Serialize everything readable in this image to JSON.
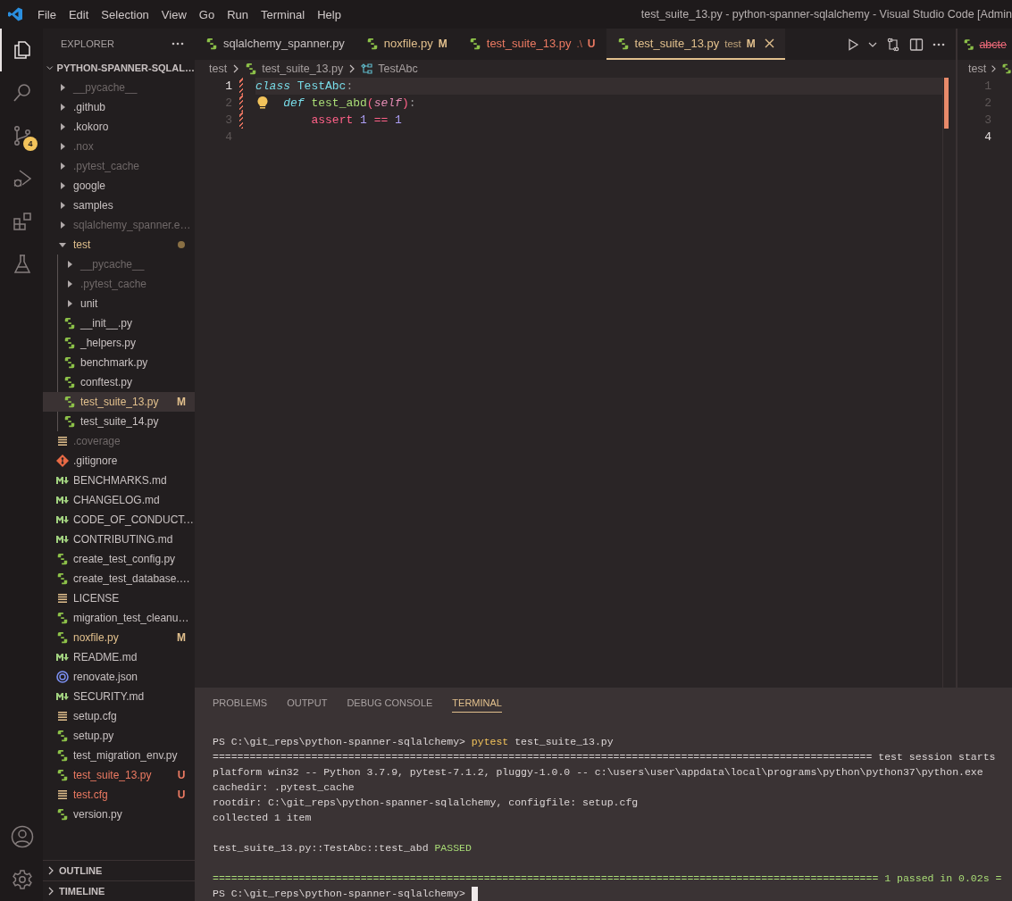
{
  "title_bar": {
    "menu": [
      "File",
      "Edit",
      "Selection",
      "View",
      "Go",
      "Run",
      "Terminal",
      "Help"
    ],
    "title": "test_suite_13.py - python-spanner-sqlalchemy - Visual Studio Code [Admin"
  },
  "activity_bar": {
    "items": [
      {
        "kind": "explorer",
        "selected": true
      },
      {
        "kind": "search",
        "selected": false
      },
      {
        "kind": "source-control",
        "selected": false,
        "badge": "4"
      },
      {
        "kind": "run-debug",
        "selected": false
      },
      {
        "kind": "extensions",
        "selected": false
      },
      {
        "kind": "testing",
        "selected": false
      }
    ],
    "bottom_items": [
      {
        "kind": "account",
        "selected": false
      },
      {
        "kind": "settings",
        "selected": false
      }
    ]
  },
  "sidebar": {
    "title": "EXPLORER",
    "section": {
      "label": "PYTHON-SPANNER-SQLAL…",
      "expanded": true
    },
    "items": [
      {
        "label": "__pycache__",
        "kind": "folder",
        "expanded": false,
        "dimmed": true,
        "modified": false,
        "untracked": false,
        "selected": false
      },
      {
        "label": ".github",
        "kind": "folder",
        "expanded": false,
        "dimmed": false,
        "modified": false,
        "untracked": false,
        "selected": false
      },
      {
        "label": ".kokoro",
        "kind": "folder",
        "expanded": false,
        "dimmed": false,
        "modified": false,
        "untracked": false,
        "selected": false
      },
      {
        "label": ".nox",
        "kind": "folder",
        "expanded": false,
        "dimmed": true,
        "modified": false,
        "untracked": false,
        "selected": false
      },
      {
        "label": ".pytest_cache",
        "kind": "folder",
        "expanded": false,
        "dimmed": true,
        "modified": false,
        "untracked": false,
        "selected": false
      },
      {
        "label": "google",
        "kind": "folder",
        "expanded": false,
        "dimmed": false,
        "modified": false,
        "untracked": false,
        "selected": false
      },
      {
        "label": "samples",
        "kind": "folder",
        "expanded": false,
        "dimmed": false,
        "modified": false,
        "untracked": false,
        "selected": false
      },
      {
        "label": "sqlalchemy_spanner.e…",
        "kind": "folder",
        "expanded": false,
        "dimmed": true,
        "modified": false,
        "untracked": false,
        "selected": false
      },
      {
        "label": "test",
        "kind": "folder",
        "expanded": true,
        "dimmed": false,
        "modified": true,
        "untracked": false,
        "selected": false,
        "children": [
          {
            "label": "__pycache__",
            "kind": "folder",
            "expanded": false,
            "dimmed": true,
            "modified": false,
            "untracked": false,
            "selected": false
          },
          {
            "label": ".pytest_cache",
            "kind": "folder",
            "expanded": false,
            "dimmed": true,
            "modified": false,
            "untracked": false,
            "selected": false
          },
          {
            "label": "unit",
            "kind": "folder",
            "expanded": false,
            "dimmed": false,
            "modified": false,
            "untracked": false,
            "selected": false
          },
          {
            "label": "__init__.py",
            "kind": "python-file",
            "dimmed": false,
            "modified": false,
            "untracked": false,
            "selected": false
          },
          {
            "label": "_helpers.py",
            "kind": "python-file",
            "dimmed": false,
            "modified": false,
            "untracked": false,
            "selected": false
          },
          {
            "label": "benchmark.py",
            "kind": "python-file",
            "dimmed": false,
            "modified": false,
            "untracked": false,
            "selected": false
          },
          {
            "label": "conftest.py",
            "kind": "python-file",
            "dimmed": false,
            "modified": false,
            "untracked": false,
            "selected": false
          },
          {
            "label": "test_suite_13.py",
            "kind": "python-file",
            "dimmed": false,
            "modified": true,
            "untracked": false,
            "badge": "M",
            "selected": true
          },
          {
            "label": "test_suite_14.py",
            "kind": "python-file",
            "dimmed": false,
            "modified": false,
            "untracked": false,
            "selected": false
          }
        ]
      },
      {
        "label": ".coverage",
        "kind": "text-file",
        "dimmed": true,
        "modified": false,
        "untracked": false,
        "selected": false
      },
      {
        "label": ".gitignore",
        "kind": "git-file",
        "dimmed": false,
        "modified": false,
        "untracked": false,
        "selected": false
      },
      {
        "label": "BENCHMARKS.md",
        "kind": "markdown-file",
        "dimmed": false,
        "modified": false,
        "untracked": false,
        "selected": false
      },
      {
        "label": "CHANGELOG.md",
        "kind": "markdown-file",
        "dimmed": false,
        "modified": false,
        "untracked": false,
        "selected": false
      },
      {
        "label": "CODE_OF_CONDUCT.…",
        "kind": "markdown-file",
        "dimmed": false,
        "modified": false,
        "untracked": false,
        "selected": false
      },
      {
        "label": "CONTRIBUTING.md",
        "kind": "markdown-file",
        "dimmed": false,
        "modified": false,
        "untracked": false,
        "selected": false
      },
      {
        "label": "create_test_config.py",
        "kind": "python-file",
        "dimmed": false,
        "modified": false,
        "untracked": false,
        "selected": false
      },
      {
        "label": "create_test_database.…",
        "kind": "python-file",
        "dimmed": false,
        "modified": false,
        "untracked": false,
        "selected": false
      },
      {
        "label": "LICENSE",
        "kind": "text-file",
        "dimmed": false,
        "modified": false,
        "untracked": false,
        "selected": false
      },
      {
        "label": "migration_test_cleanu…",
        "kind": "python-file",
        "dimmed": false,
        "modified": false,
        "untracked": false,
        "selected": false
      },
      {
        "label": "noxfile.py",
        "kind": "python-file",
        "dimmed": false,
        "modified": true,
        "untracked": false,
        "badge": "M",
        "selected": false
      },
      {
        "label": "README.md",
        "kind": "markdown-file",
        "dimmed": false,
        "modified": false,
        "untracked": false,
        "selected": false
      },
      {
        "label": "renovate.json",
        "kind": "json-file",
        "dimmed": false,
        "modified": false,
        "untracked": false,
        "selected": false
      },
      {
        "label": "SECURITY.md",
        "kind": "markdown-file",
        "dimmed": false,
        "modified": false,
        "untracked": false,
        "selected": false
      },
      {
        "label": "setup.cfg",
        "kind": "text-file",
        "dimmed": false,
        "modified": false,
        "untracked": false,
        "selected": false
      },
      {
        "label": "setup.py",
        "kind": "python-file",
        "dimmed": false,
        "modified": false,
        "untracked": false,
        "selected": false
      },
      {
        "label": "test_migration_env.py",
        "kind": "python-file",
        "dimmed": false,
        "modified": false,
        "untracked": false,
        "selected": false
      },
      {
        "label": "test_suite_13.py",
        "kind": "python-file",
        "dimmed": false,
        "modified": false,
        "untracked": true,
        "badge": "U",
        "selected": false
      },
      {
        "label": "test.cfg",
        "kind": "text-file",
        "dimmed": false,
        "modified": false,
        "untracked": true,
        "badge": "U",
        "selected": false
      },
      {
        "label": "version.py",
        "kind": "python-file",
        "dimmed": false,
        "modified": false,
        "untracked": false,
        "selected": false
      }
    ],
    "bottom_sections": [
      {
        "label": "OUTLINE",
        "expanded": false
      },
      {
        "label": "TIMELINE",
        "expanded": false
      }
    ]
  },
  "editor": {
    "tabs": [
      {
        "label": "sqlalchemy_spanner.py",
        "modified": false,
        "untracked": false,
        "selected": false
      },
      {
        "label": "noxfile.py",
        "modified": true,
        "untracked": false,
        "badge": "M",
        "selected": false
      },
      {
        "label": "test_suite_13.py",
        "description": ".\\",
        "modified": false,
        "untracked": true,
        "badge": "U",
        "selected": false
      },
      {
        "label": "test_suite_13.py",
        "description": "test",
        "modified": true,
        "untracked": false,
        "badge": "M",
        "selected": true
      }
    ],
    "breadcrumb": [
      {
        "label": "test",
        "kind": "folder"
      },
      {
        "label": "test_suite_13.py",
        "kind": "python"
      },
      {
        "label": "TestAbc",
        "kind": "class"
      }
    ],
    "lines": [
      {
        "number": "1",
        "current": true,
        "changed": true,
        "lightbulb": false,
        "tokens": [
          {
            "text": "class",
            "kind": "storage"
          },
          {
            "text": " TestAbc",
            "kind": "type"
          },
          {
            "text": ":",
            "kind": "punct"
          }
        ]
      },
      {
        "number": "2",
        "current": false,
        "changed": true,
        "lightbulb": true,
        "tokens": [
          {
            "text": "    def",
            "kind": "storage"
          },
          {
            "text": " test_abd",
            "kind": "function"
          },
          {
            "text": "(",
            "kind": "operator"
          },
          {
            "text": "self",
            "kind": "param"
          },
          {
            "text": ")",
            "kind": "operator"
          },
          {
            "text": ":",
            "kind": "punct"
          }
        ]
      },
      {
        "number": "3",
        "current": false,
        "changed": true,
        "lightbulb": false,
        "tokens": [
          {
            "text": "        assert",
            "kind": "keyword"
          },
          {
            "text": " 1",
            "kind": "number"
          },
          {
            "text": " ==",
            "kind": "operator"
          },
          {
            "text": " 1",
            "kind": "number"
          }
        ]
      },
      {
        "number": "4",
        "current": false,
        "changed": false,
        "lightbulb": false
      }
    ]
  },
  "side_editor": {
    "tab": {
      "label": "abcte",
      "deleted": true
    },
    "breadcrumb": "test",
    "lines": [
      {
        "number": "1",
        "current": false
      },
      {
        "number": "2",
        "current": false
      },
      {
        "number": "3",
        "current": false
      },
      {
        "number": "4",
        "current": true
      }
    ]
  },
  "panel": {
    "tabs": [
      {
        "label": "PROBLEMS",
        "selected": false
      },
      {
        "label": "OUTPUT",
        "selected": false
      },
      {
        "label": "DEBUG CONSOLE",
        "selected": false
      },
      {
        "label": "TERMINAL",
        "selected": true
      }
    ],
    "terminal": [
      {
        "kind": "text",
        "segments": [
          {
            "text": "PS C:\\git_reps\\python-spanner-sqlalchemy> ",
            "kind": "plain"
          },
          {
            "text": "pytest",
            "kind": "command"
          },
          {
            "text": " test_suite_13.py",
            "kind": "plain"
          }
        ]
      },
      {
        "kind": "text",
        "segments": [
          {
            "text": "=========================================================================================================== test session starts",
            "kind": "plain"
          }
        ]
      },
      {
        "kind": "text",
        "segments": [
          {
            "text": "platform win32 -- Python 3.7.9, pytest-7.1.2, pluggy-1.0.0 -- c:\\users\\user\\appdata\\local\\programs\\python\\python37\\python.exe",
            "kind": "plain"
          }
        ]
      },
      {
        "kind": "text",
        "segments": [
          {
            "text": "cachedir: .pytest_cache",
            "kind": "plain"
          }
        ]
      },
      {
        "kind": "text",
        "segments": [
          {
            "text": "rootdir: C:\\git_reps\\python-spanner-sqlalchemy, configfile: setup.cfg",
            "kind": "plain"
          }
        ]
      },
      {
        "kind": "text",
        "segments": [
          {
            "text": "collected 1 item",
            "kind": "plain"
          }
        ]
      },
      {
        "kind": "blank"
      },
      {
        "kind": "text",
        "segments": [
          {
            "text": "test_suite_13.py::TestAbc::test_abd ",
            "kind": "plain"
          },
          {
            "text": "PASSED",
            "kind": "pass"
          }
        ]
      },
      {
        "kind": "blank"
      },
      {
        "kind": "text",
        "segments": [
          {
            "text": "============================================================================================================ 1 passed in 0.02s =",
            "kind": "pass"
          }
        ]
      },
      {
        "kind": "text",
        "cursor": true,
        "segments": [
          {
            "text": "PS C:\\git_reps\\python-spanner-sqlalchemy> ",
            "kind": "plain"
          }
        ]
      }
    ]
  }
}
